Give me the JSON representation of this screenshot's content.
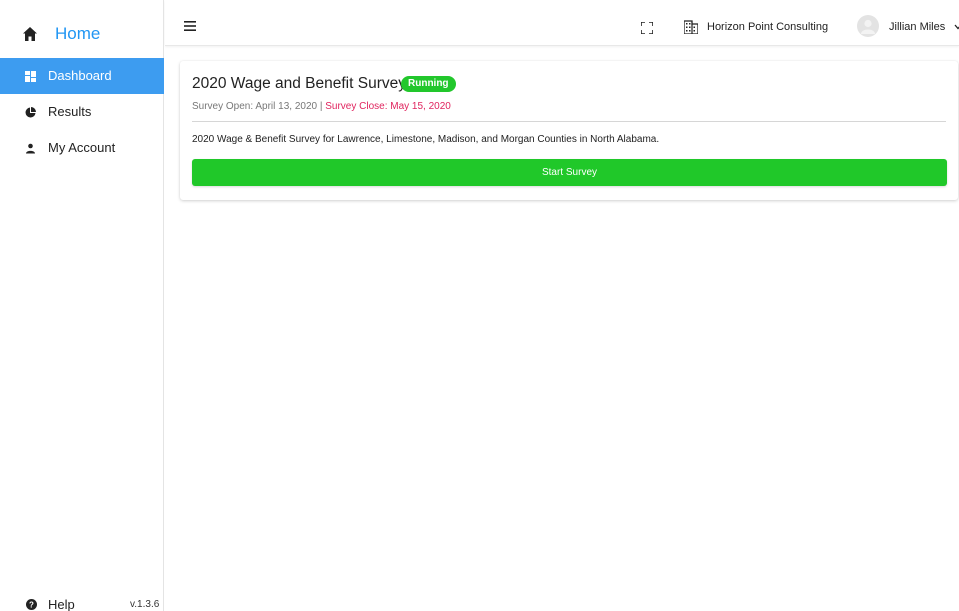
{
  "sidebar": {
    "brand_label": "Home",
    "items": [
      {
        "label": "Dashboard",
        "icon": "dashboard-icon",
        "active": true
      },
      {
        "label": "Results",
        "icon": "pie-chart-icon",
        "active": false
      },
      {
        "label": "My Account",
        "icon": "person-icon",
        "active": false
      }
    ],
    "help_label": "Help",
    "version": "v.1.3.6"
  },
  "topbar": {
    "organization": "Horizon Point Consulting",
    "user_name": "Jillian Miles"
  },
  "survey": {
    "title": "2020 Wage and Benefit Survey",
    "status": "Running",
    "open_text": "Survey Open: April 13, 2020",
    "separator": " | ",
    "close_text": "Survey Close: May 15, 2020",
    "description": "2020 Wage & Benefit Survey for Lawrence, Limestone, Madison, and Morgan Counties in North Alabama.",
    "start_label": "Start Survey"
  },
  "colors": {
    "accent": "#2196f3",
    "active_nav": "#3d9cf0",
    "running_badge": "#22c72c",
    "start_button": "#20c829",
    "close_date": "#e0245e"
  }
}
